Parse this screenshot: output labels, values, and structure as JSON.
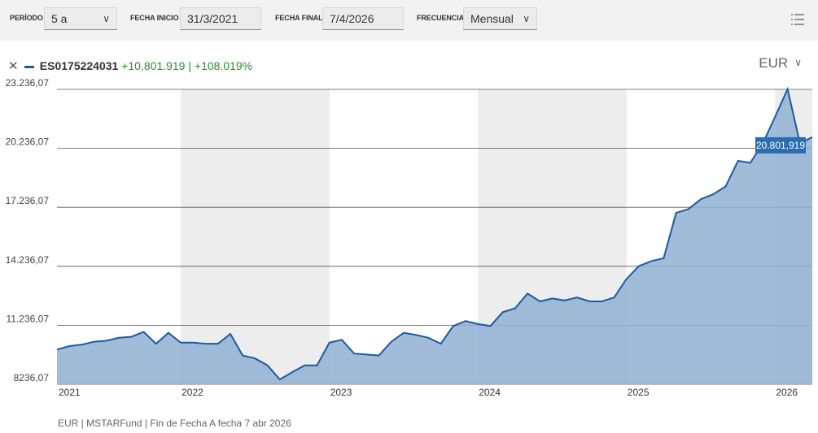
{
  "toolbar": {
    "period_label": "PERÍODO",
    "period_value": "5 a",
    "start_label": "FECHA INICIO",
    "start_value": "31/3/2021",
    "end_label": "FECHA FINAL",
    "end_value": "7/4/2026",
    "freq_label": "FRECUENCIA",
    "freq_value": "Mensual",
    "menu_icon": "hamburger-menu-icon"
  },
  "legend": {
    "close_icon": "close-icon",
    "ticker": "ES0175224031",
    "change_abs": "+10,801.919",
    "separator": "|",
    "change_pct": "+108.019%"
  },
  "currency": {
    "value": "EUR",
    "icon": "chevron-down-icon"
  },
  "footer": {
    "text": "EUR | MSTARFund | Fin de Fecha A fecha 7 abr 2026"
  },
  "colors": {
    "line": "#1c5aa0",
    "area": "#8fb0d2",
    "band": "#ededed",
    "gain": "#2e8b2e"
  },
  "chart_data": {
    "type": "area",
    "series": [
      {
        "name": "ES0175224031",
        "x": [
          "2021-03",
          "2021-04",
          "2021-05",
          "2021-06",
          "2021-07",
          "2021-08",
          "2021-09",
          "2021-10",
          "2021-11",
          "2021-12",
          "2022-01",
          "2022-02",
          "2022-03",
          "2022-04",
          "2022-05",
          "2022-06",
          "2022-07",
          "2022-08",
          "2022-09",
          "2022-10",
          "2022-11",
          "2022-12",
          "2023-01",
          "2023-02",
          "2023-03",
          "2023-04",
          "2023-05",
          "2023-06",
          "2023-07",
          "2023-08",
          "2023-09",
          "2023-10",
          "2023-11",
          "2023-12",
          "2024-01",
          "2024-02",
          "2024-03",
          "2024-04",
          "2024-05",
          "2024-06",
          "2024-07",
          "2024-08",
          "2024-09",
          "2024-10",
          "2024-11",
          "2024-12",
          "2025-01",
          "2025-02",
          "2025-03",
          "2025-04",
          "2025-05",
          "2025-06",
          "2025-07",
          "2025-08",
          "2025-09",
          "2025-10",
          "2025-11",
          "2025-12",
          "2026-01",
          "2026-02",
          "2026-03",
          "2026-04"
        ],
        "values": [
          10000,
          10180,
          10250,
          10400,
          10450,
          10600,
          10650,
          10900,
          10300,
          10850,
          10350,
          10350,
          10300,
          10300,
          10800,
          9700,
          9550,
          9200,
          8480,
          8850,
          9200,
          9200,
          10350,
          10500,
          9800,
          9750,
          9700,
          10400,
          10850,
          10750,
          10600,
          10300,
          11200,
          11450,
          11300,
          11200,
          11900,
          12100,
          12850,
          12450,
          12600,
          12500,
          12650,
          12450,
          12450,
          12650,
          13600,
          14250,
          14500,
          14650,
          16950,
          17150,
          17650,
          17900,
          18300,
          19600,
          19500,
          20480,
          21850,
          23250,
          20500,
          20802
        ]
      }
    ],
    "last_value_label": "20.801,919",
    "xticks": [
      "2021",
      "2022",
      "2023",
      "2024",
      "2025",
      "2026"
    ],
    "yticks": [
      "8236,07",
      "11.236,07",
      "14.236,07",
      "17.236,07",
      "20.236,07",
      "23.236,07"
    ],
    "ytick_values": [
      8236.07,
      11236.07,
      14236.07,
      17236.07,
      20236.07,
      23236.07
    ],
    "ylim": [
      8236.07,
      23236.07
    ],
    "grid": "horizontal",
    "shaded_years": [
      "2022",
      "2024",
      "2026"
    ]
  }
}
